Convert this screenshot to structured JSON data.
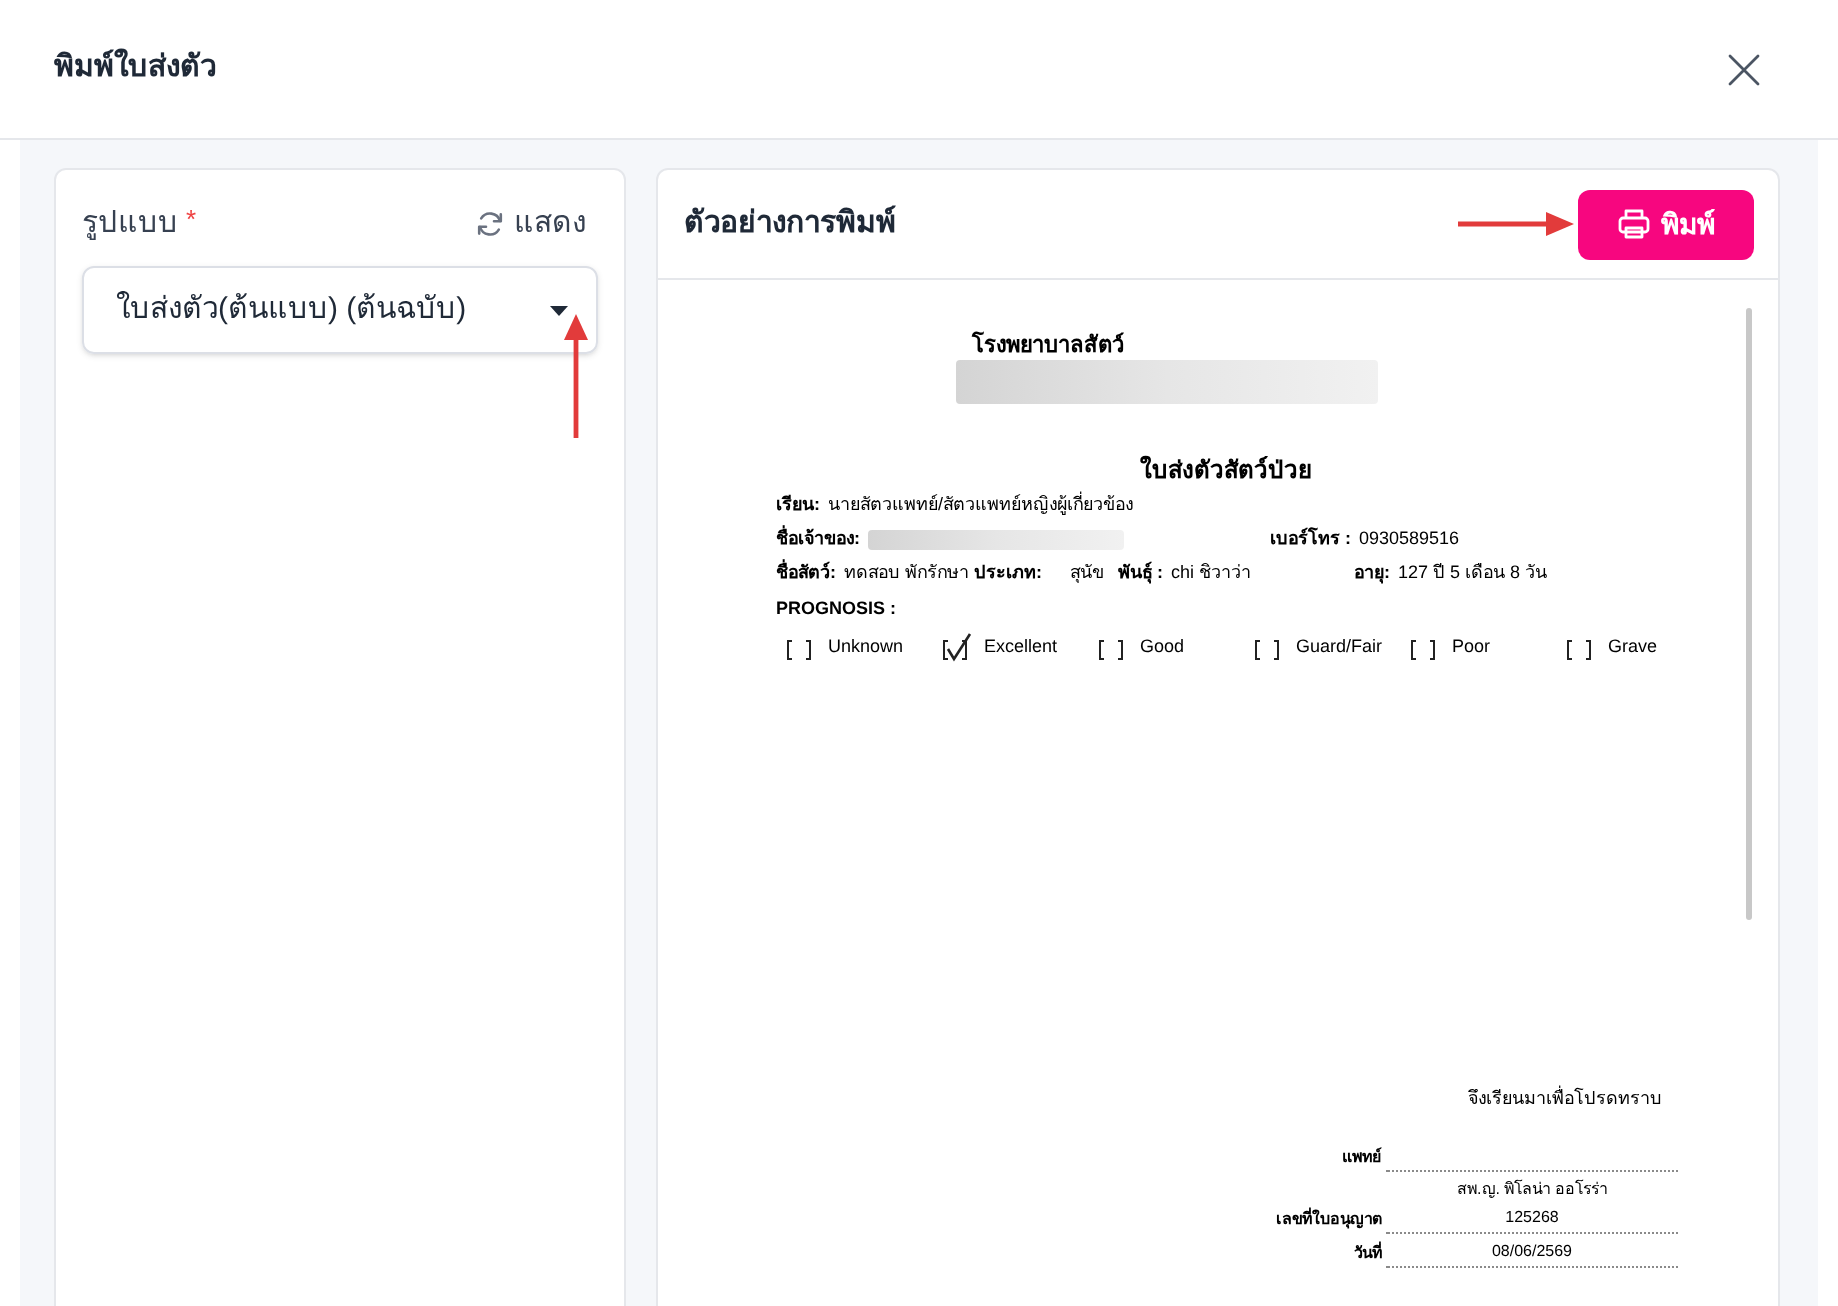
{
  "dialog": {
    "title": "พิมพ์ใบส่งตัว"
  },
  "form": {
    "label": "รูปแบบ",
    "required_mark": "*",
    "show_button": "แสดง",
    "template_select": {
      "value": "ใบส่งตัว(ต้นแบบ) (ต้นฉบับ)"
    }
  },
  "preview": {
    "title": "ตัวอย่างการพิมพ์",
    "print_button": "พิมพ์",
    "document": {
      "hospital": {
        "label": "โรงพยาบาลสัตว์",
        "redacted": true
      },
      "title": "ใบส่งตัวสัตว์ป่วย",
      "addressee": {
        "label": "เรียน:",
        "value": "นายสัตวแพทย์/สัตวแพทย์หญิงผู้เกี่ยวข้อง"
      },
      "owner": {
        "label": "ชื่อเจ้าของ:",
        "redacted": true
      },
      "phone": {
        "label": "เบอร์โทร :",
        "value": "0930589516"
      },
      "pet_name": {
        "label": "ชื่อสัตว์:",
        "value": "ทดสอบ พักรักษา"
      },
      "species": {
        "label": "ประเภท:",
        "value": "สุนัข"
      },
      "breed": {
        "label": "พันธุ์ :",
        "value": "chi ชิวาว่า"
      },
      "age": {
        "label": "อายุ:",
        "value": "127 ปี 5 เดือน 8 วัน"
      },
      "prognosis": {
        "label": "PROGNOSIS :",
        "options": [
          {
            "label": "Unknown",
            "checked": false
          },
          {
            "label": "Excellent",
            "checked": true
          },
          {
            "label": "Good",
            "checked": false
          },
          {
            "label": "Guard/Fair",
            "checked": false
          },
          {
            "label": "Poor",
            "checked": false
          },
          {
            "label": "Grave",
            "checked": false
          }
        ]
      },
      "closing": "จึงเรียนมาเพื่อโปรดทราบ",
      "signature": {
        "label": "แพทย์",
        "name": "สพ.ญ. พิโลน่า ออโรร่า"
      },
      "license": {
        "label": "เลขที่ใบอนุญาต",
        "value": "125268"
      },
      "date": {
        "label": "วันที่",
        "value": "08/06/2569"
      }
    }
  }
}
